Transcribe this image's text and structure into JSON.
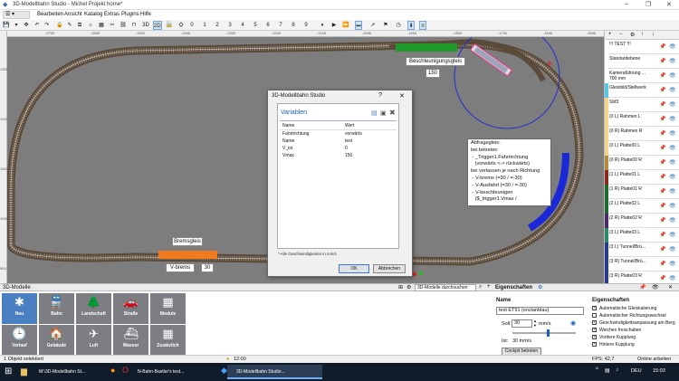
{
  "window": {
    "title": "3D-Modellbahn Studio - Michel Projekt home*",
    "min": "–",
    "max": "❐",
    "close": "✕"
  },
  "menu": [
    "Bearbeiten",
    "Ansicht",
    "Katalog",
    "Extras",
    "Plugins",
    "Hilfe"
  ],
  "toolbar": {
    "view2d": "2D",
    "view3d": "3D",
    "digits": [
      "0",
      "1",
      "2",
      "3",
      "4",
      "5",
      "6",
      "7",
      "8",
      "9"
    ]
  },
  "rulers": {
    "top": [
      "-2700",
      "-2600",
      "-2500",
      "-2400",
      "-2300",
      "-2200",
      "-2100",
      "-2000",
      "-1900",
      "-1800",
      "-1700",
      "-1600",
      "-1500"
    ],
    "left": [
      "1300",
      "1200",
      "1100",
      "1000",
      "900"
    ]
  },
  "labels": {
    "beschleunigung": "Beschleunigungsgleis",
    "beschleunigung_value": "150",
    "bremsgleis": "Bremsgleis",
    "vbrems": "V-brems",
    "vbrems_value": "30"
  },
  "note": [
    "Abfragegleis:",
    "bei betreten",
    " - _Trigger1.Fahrtrichtung",
    "   (vorwärts <-> rückwärts)",
    "bei verlassen je nach Richtung",
    " - V-brems (=30 / =-30)",
    " - V-Ausfahrt (=30 / =-30)",
    " - V-beschleunigen",
    "   ($_trigger1.Vmax /"
  ],
  "dialog": {
    "title": "3D-Modellbahn Studio",
    "help": "?",
    "close": "✕",
    "heading": "Variablen",
    "col_name": "Name",
    "col_value": "Wert",
    "rows": [
      {
        "name": "Fahrtrichtung",
        "value": "vorwärts"
      },
      {
        "name": "Name",
        "value": "test"
      },
      {
        "name": "V_ist",
        "value": "0"
      },
      {
        "name": "Vmax",
        "value": "150"
      }
    ],
    "footnote": "* Alle Geschwindigkeiten in mm/s",
    "ok": "OK",
    "cancel": "Abbrechen"
  },
  "layers": [
    {
      "name": "!!! TEST !!!",
      "color": "#ffffff"
    },
    {
      "name": "Standardebene",
      "color": "#ffffff"
    },
    {
      "name": "Kameraführung ...",
      "sub": "700 mm",
      "color": "#ffffff"
    },
    {
      "name": "Gleisbild/Stellwerk",
      "color": "#55c8e8"
    },
    {
      "name": "Sbf3",
      "color": "#f3d58a"
    },
    {
      "name": "(0 L) Rahmen L",
      "color": "#f3d58a"
    },
    {
      "name": "(0 R) Rahmen R",
      "color": "#f3d58a"
    },
    {
      "name": "(0 L) Platte00 L",
      "color": "#f3d58a"
    },
    {
      "name": "(0 R) Platte00 R",
      "color": "#b58a3c"
    },
    {
      "name": "(1 L) Platte01 L",
      "color": "#8b2a1a"
    },
    {
      "name": "(1 R) Platte01 R",
      "color": "#1e6a2a"
    },
    {
      "name": "(2 L) Platte02 L",
      "color": "#1e6a2a"
    },
    {
      "name": "(2 R) Platte02 R",
      "color": "#4a2a6a"
    },
    {
      "name": "(3 L) Platte03 L",
      "color": "#2a8a6a"
    },
    {
      "name": "(3 L) Tunnel/Brü...",
      "color": "#2a3a8a"
    },
    {
      "name": "(3 R) Tunnel/Brü...",
      "color": "#2a3a8a"
    },
    {
      "name": "(3 R) Platte03 R",
      "color": "#2a3a8a"
    }
  ],
  "bottombar": {
    "left_title": "3D-Modelle",
    "search": "3D-Modelle durchsuchen",
    "right_title": "Eigenschaften"
  },
  "tiles": [
    {
      "label": "Neu",
      "glyph": "✱"
    },
    {
      "label": "Bahn",
      "glyph": "🚆"
    },
    {
      "label": "Landschaft",
      "glyph": "🌲"
    },
    {
      "label": "Straße",
      "glyph": "🚗"
    },
    {
      "label": "Module",
      "glyph": "▦"
    },
    {
      "label": "Verlauf",
      "glyph": "🕒"
    },
    {
      "label": "Gebäude",
      "glyph": "🏠"
    },
    {
      "label": "Luft",
      "glyph": "✈"
    },
    {
      "label": "Wasser",
      "glyph": "⛴"
    },
    {
      "label": "Zusätzlich",
      "glyph": "▦"
    }
  ],
  "props": {
    "name_label": "Name",
    "name_value": "test ET91 (enzianblau)",
    "soll_label": "Soll:",
    "soll_value": "30",
    "soll_unit": "mm/s",
    "ist_label": "Ist:",
    "ist_value": "30 mm/s",
    "cockpit": "Cockpit betreten",
    "eigen_title": "Eigenschaften",
    "checks": [
      "Automatische Gleiskalierung",
      "Automatischer Richtungswechsel",
      "Geschwindigkeitsanpassung am Berg",
      "Weichen freischalten",
      "Vordere Kupplung",
      "Hintere Kupplung"
    ],
    "checked": [
      true,
      false,
      true,
      true,
      true,
      true
    ]
  },
  "status": {
    "left": "1 Objekt selektiert",
    "time": "12:00",
    "fps": "FPS: 42,7",
    "online": "Online arbeiten"
  },
  "taskbar": {
    "items": [
      "M:\\3D-Modellbahn St...",
      "N-Bahn-Bastler's test...",
      "3D-Modellbahn Studio..."
    ],
    "lang": "DEU",
    "clock": "15:03"
  }
}
